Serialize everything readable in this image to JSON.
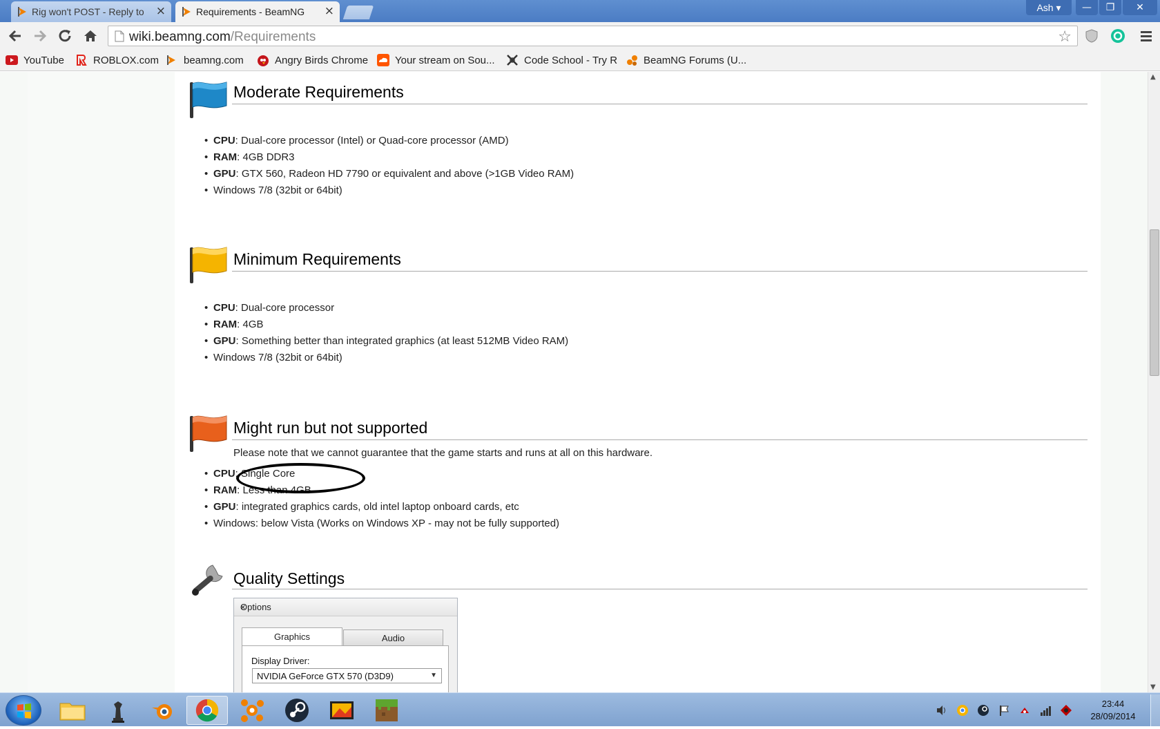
{
  "browser": {
    "tabs": [
      {
        "title": "Rig won't POST - Reply to",
        "close": "×"
      },
      {
        "title": "Requirements - BeamNG",
        "close": "×"
      }
    ],
    "profile": "Ash ▾",
    "window_buttons": {
      "minimize": "—",
      "restore": "❐",
      "close": "✕"
    },
    "url_domain": "wiki.beamng.com",
    "url_path": "/Requirements",
    "bookmarks": [
      {
        "label": "YouTube",
        "icon": "youtube-icon",
        "color": "#cc181e"
      },
      {
        "label": "ROBLOX.com",
        "icon": "roblox-icon",
        "color": "#e2231a"
      },
      {
        "label": "beamng.com",
        "icon": "beamng-icon",
        "color": "#f08000"
      },
      {
        "label": "Angry Birds Chrome",
        "icon": "angry-birds-icon",
        "color": "#c4161c"
      },
      {
        "label": "Your stream on Sou...",
        "icon": "soundcloud-icon",
        "color": "#ff5500"
      },
      {
        "label": "Code School - Try R",
        "icon": "code-school-icon",
        "color": "#333333"
      },
      {
        "label": "BeamNG Forums (U...",
        "icon": "beamng-forums-icon",
        "color": "#f08000"
      }
    ]
  },
  "page": {
    "sections": [
      {
        "title": "Moderate Requirements",
        "flag_color": "#1e88c8",
        "items": [
          {
            "key": "CPU",
            "text": ": Dual-core processor (Intel) or Quad-core processor (AMD)"
          },
          {
            "key": "RAM",
            "text": ": 4GB DDR3"
          },
          {
            "key": "GPU",
            "text": ": GTX 560, Radeon HD 7790 or equivalent and above (>1GB Video RAM)"
          },
          {
            "key": "",
            "text": "Windows 7/8 (32bit or 64bit)"
          }
        ]
      },
      {
        "title": "Minimum Requirements",
        "flag_color": "#f5b400",
        "items": [
          {
            "key": "CPU",
            "text": ": Dual-core processor"
          },
          {
            "key": "RAM",
            "text": ": 4GB"
          },
          {
            "key": "GPU",
            "text": ": Something better than integrated graphics (at least 512MB Video RAM)"
          },
          {
            "key": "",
            "text": "Windows 7/8 (32bit or 64bit)"
          }
        ]
      },
      {
        "title": "Might run but not supported",
        "flag_color": "#e8601c",
        "note": "Please note that we cannot guarantee that the game starts and runs at all on this hardware.",
        "items": [
          {
            "key": "CPU",
            "text": ": Single Core"
          },
          {
            "key": "RAM",
            "text": ": Less than 4GB"
          },
          {
            "key": "GPU",
            "text": ": integrated graphics cards, old intel laptop onboard cards, etc"
          },
          {
            "key": "",
            "text": "Windows: below Vista (Works on Windows XP - may not be fully supported)"
          }
        ]
      },
      {
        "title": "Quality Settings"
      }
    ],
    "options_dialog": {
      "title": "Options",
      "close": "×",
      "tabs": [
        "Graphics",
        "Audio"
      ],
      "display_driver_label": "Display Driver:",
      "display_driver_value": "NVIDIA GeForce GTX 570 (D3D9)"
    }
  },
  "taskbar": {
    "apps": [
      "file-explorer-icon",
      "chess-icon",
      "blender-icon",
      "chrome-icon",
      "avast-icon",
      "steam-icon",
      "media-icon",
      "minecraft-icon"
    ],
    "clock_time": "23:44",
    "clock_date": "28/09/2014"
  }
}
